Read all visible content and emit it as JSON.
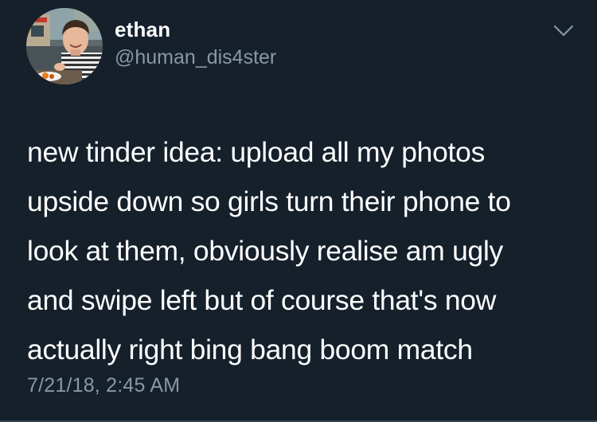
{
  "tweet": {
    "display_name": "ethan",
    "handle": "@human_dis4ster",
    "text": "new tinder idea: upload all my photos\nupside down so girls turn their phone to\nlook at them, obviously realise am ugly\nand swipe left but of course that's now\nactually right bing bang boom match",
    "timestamp": "7/21/18, 2:45 AM"
  },
  "icons": {
    "avatar": "profile-photo",
    "menu": "chevron-down-icon"
  },
  "colors": {
    "background": "#15202b",
    "primary_text": "#ffffff",
    "secondary_text": "#8899a6"
  }
}
